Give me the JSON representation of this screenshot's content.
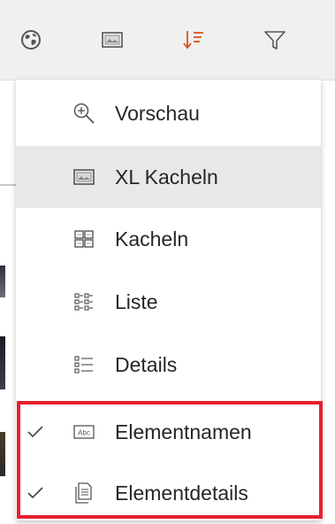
{
  "colors": {
    "accent": "#d9541e",
    "highlight": "#e8202e",
    "selected_bg": "#e8e8e8",
    "toolbar_bg": "#f0f0f0",
    "text": "#262626"
  },
  "toolbar": {
    "buttons": [
      {
        "icon": "globe-icon"
      },
      {
        "icon": "thumbnail-icon"
      },
      {
        "icon": "sort-icon",
        "active": true
      },
      {
        "icon": "filter-icon"
      }
    ]
  },
  "menu": {
    "items": [
      {
        "label": "Vorschau",
        "icon": "zoom-in-icon",
        "checked": false,
        "selected": false
      },
      {
        "label": "XL Kacheln",
        "icon": "xl-tiles-icon",
        "checked": false,
        "selected": true
      },
      {
        "label": "Kacheln",
        "icon": "tiles-icon",
        "checked": false,
        "selected": false
      },
      {
        "label": "Liste",
        "icon": "list-icon",
        "checked": false,
        "selected": false
      },
      {
        "label": "Details",
        "icon": "details-icon",
        "checked": false,
        "selected": false
      },
      {
        "label": "Elementnamen",
        "icon": "element-names-icon",
        "checked": true,
        "selected": false
      },
      {
        "label": "Elementdetails",
        "icon": "element-details-icon",
        "checked": true,
        "selected": false
      }
    ]
  }
}
